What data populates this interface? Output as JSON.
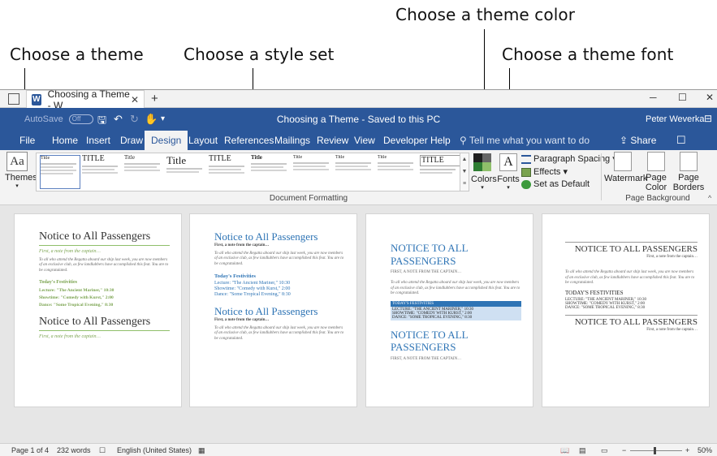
{
  "callouts": {
    "theme_color": "Choose a theme color",
    "theme": "Choose a theme",
    "style_set": "Choose a style set",
    "theme_font": "Choose a theme font"
  },
  "window": {
    "tab_title": "Choosing a Theme - W",
    "title": "Choosing a Theme - Saved to this PC",
    "autosave_label": "AutoSave",
    "autosave_state": "Off",
    "user_name": "Peter Weverka"
  },
  "ribbon_tabs": [
    "File",
    "Home",
    "Insert",
    "Draw",
    "Design",
    "Layout",
    "References",
    "Mailings",
    "Review",
    "View",
    "Developer",
    "Help"
  ],
  "active_tab": "Design",
  "tell_me": "Tell me what you want to do",
  "share_label": "Share",
  "ribbon": {
    "themes_label": "Themes",
    "style_thumb_titles": [
      "Title",
      "TITLE",
      "Title",
      "Title",
      "TITLE",
      "Title",
      "Title",
      "Title",
      "Title",
      "TITLE"
    ],
    "colors_label": "Colors",
    "fonts_label": "Fonts",
    "paragraph_spacing": "Paragraph Spacing",
    "effects": "Effects",
    "set_default": "Set as Default",
    "watermark": "Watermark",
    "page_color": "Page Color",
    "page_borders": "Page Borders",
    "group_document_formatting": "Document Formatting",
    "group_page_background": "Page Background"
  },
  "swatch_colors": [
    "#1f1f1f",
    "#666666",
    "#2e7d32",
    "#8fbf6a"
  ],
  "accent_color": "#2b579a",
  "pages": [
    {
      "title": "Notice to All Passengers",
      "subtitle": "First, a note from the captain…",
      "body": "To all who attend the Regatta aboard our ship last week, you are now members of an exclusive club, as few landlubbers have accomplished this feat. You are to be congratulated.",
      "heading": "Today's Festivities",
      "items": [
        "Lecture: \"The Ancient Mariner,\" 10:30",
        "Showtime: \"Comedy with Kurst,\" 2:00",
        "Dance: \"Some Tropical Evening,\" 8:30"
      ],
      "title2": "Notice to All Passengers",
      "subtitle2": "First, a note from the captain…"
    },
    {
      "title": "Notice to All Passengers",
      "subtitle": "First, a note from the captain…",
      "body": "To all who attend the Regatta aboard our ship last week, you are now members of an exclusive club, as few landlubbers have accomplished this feat. You are to be congratulated.",
      "heading": "Today's Festivities",
      "items": [
        "Lecture: \"The Ancient Mariner,\" 10:30",
        "Showtime: \"Comedy with Kurst,\" 2:00",
        "Dance: \"Some Tropical Evening,\" 8:30"
      ],
      "title2": "Notice to All Passengers",
      "subtitle2": "First, a note from the captain…",
      "body2": "To all who attend the Regatta aboard our ship last week, you are now members of an exclusive club, as few landlubbers have accomplished this feat. You are to be congratulated."
    },
    {
      "title": "NOTICE TO ALL PASSENGERS",
      "subtitle": "FIRST, A NOTE FROM THE CAPTAIN…",
      "body": "To all who attend the Regatta aboard our ship last week, you are now members of an exclusive club, as few landlubbers have accomplished this feat. You are to be congratulated.",
      "heading": "TODAY'S FESTIVITIES",
      "items": [
        "LECTURE: \"THE ANCIENT MARINER,\" 10:30",
        "SHOWTIME: \"COMEDY WITH KURST,\" 2:00",
        "DANCE: \"SOME TROPICAL EVENING,\" 8:30"
      ],
      "title2": "NOTICE TO ALL PASSENGERS",
      "subtitle2": "FIRST, A NOTE FROM THE CAPTAIN…"
    },
    {
      "title": "NOTICE TO ALL PASSENGERS",
      "subtitle": "First, a note from the captain…",
      "body": "To all who attend the Regatta aboard our ship last week, you are now members of an exclusive club, as few landlubbers have accomplished this feat. You are to be congratulated.",
      "heading": "TODAY'S FESTIVITIES",
      "items": [
        "LECTURE: \"THE ANCIENT MARINER,\" 10:30",
        "SHOWTIME: \"COMEDY WITH KURST,\" 2:00",
        "DANCE: \"SOME TROPICAL EVENING,\" 8:30"
      ],
      "title2": "NOTICE TO ALL PASSENGERS",
      "subtitle2": "First, a note from the captain…"
    }
  ],
  "status": {
    "page": "Page 1 of 4",
    "words": "232 words",
    "language": "English (United States)",
    "zoom": "50%"
  }
}
